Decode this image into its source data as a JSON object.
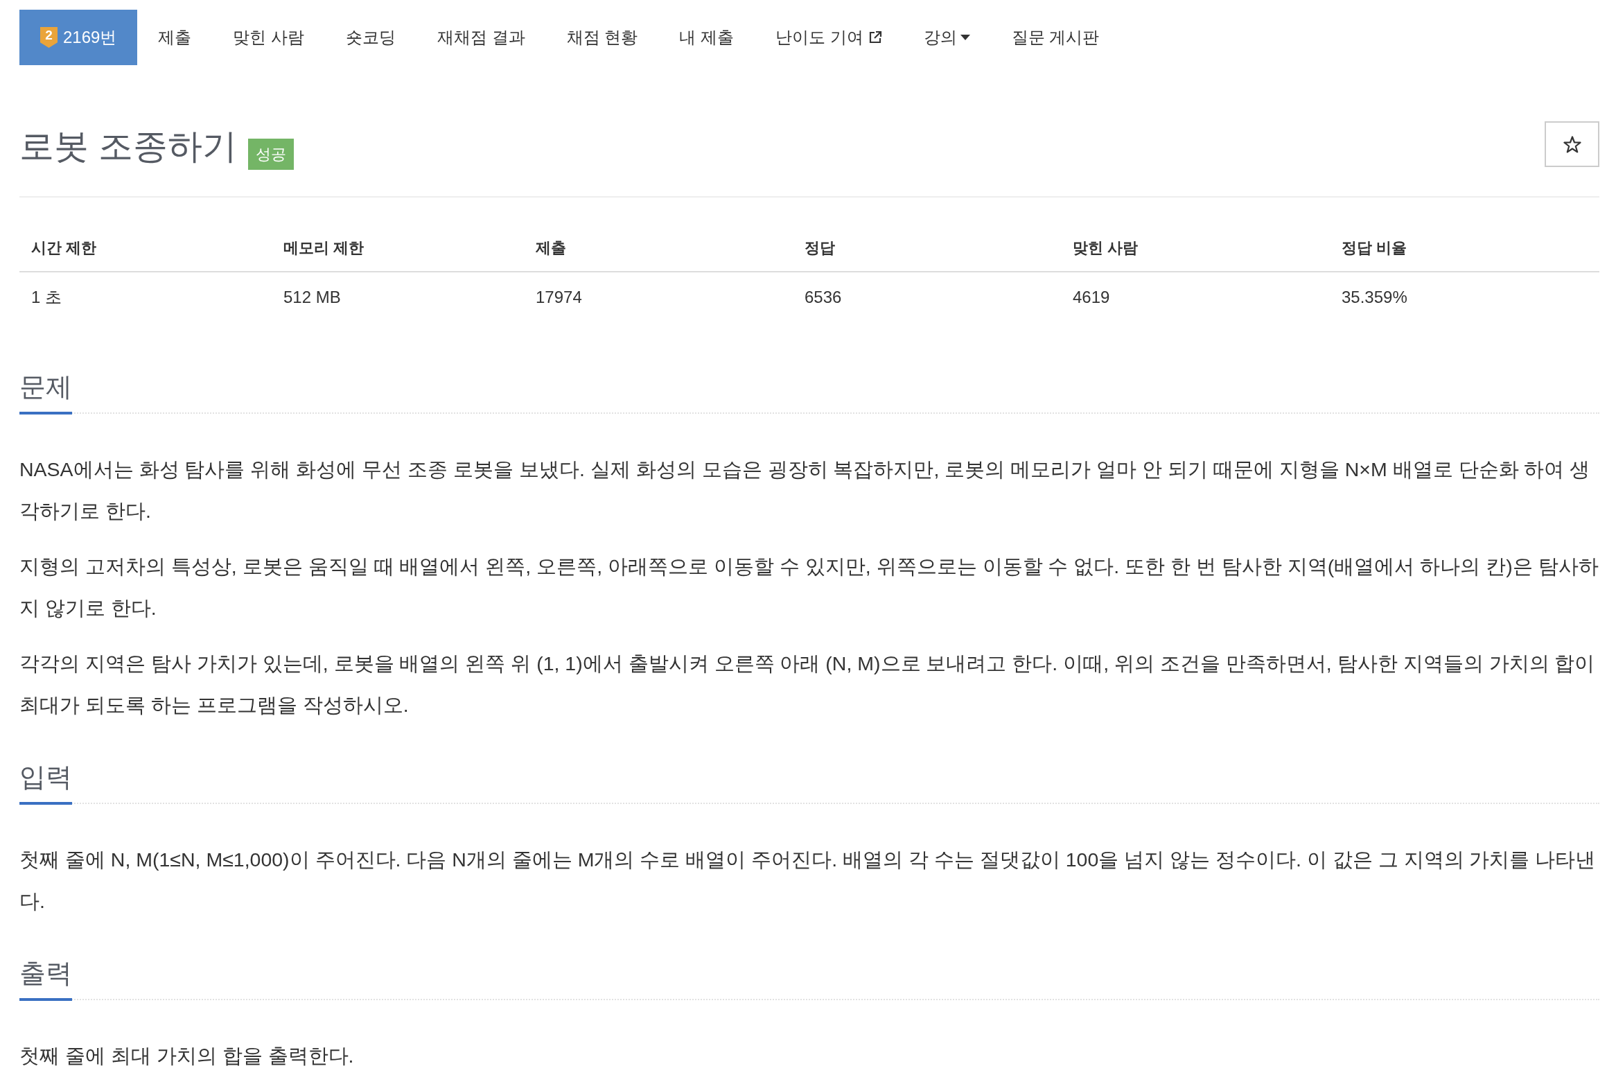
{
  "nav": {
    "tabs": [
      {
        "kind": "problem",
        "tier": "2",
        "label": "2169번",
        "selected": true
      },
      {
        "kind": "link",
        "label": "제출",
        "selected": false
      },
      {
        "kind": "link",
        "label": "맞힌 사람",
        "selected": false
      },
      {
        "kind": "link",
        "label": "숏코딩",
        "selected": false
      },
      {
        "kind": "link",
        "label": "재채점 결과",
        "selected": false
      },
      {
        "kind": "link",
        "label": "채점 현황",
        "selected": false
      },
      {
        "kind": "link",
        "label": "내 제출",
        "selected": false
      },
      {
        "kind": "external",
        "label": "난이도 기여",
        "selected": false
      },
      {
        "kind": "dropdown",
        "label": "강의",
        "selected": false
      },
      {
        "kind": "link",
        "label": "질문 게시판",
        "selected": false
      }
    ]
  },
  "problem": {
    "title": "로봇 조종하기",
    "result_badge": {
      "kind": "success",
      "label": "성공"
    },
    "starred": false
  },
  "limits_table": {
    "columns": [
      "시간 제한",
      "메모리 제한",
      "제출",
      "정답",
      "맞힌 사람",
      "정답 비율"
    ],
    "rows": [
      [
        "1 초",
        "512 MB",
        "17974",
        "6536",
        "4619",
        "35.359%"
      ]
    ]
  },
  "sections": [
    {
      "heading": "문제",
      "paragraphs": [
        "NASA에서는 화성 탐사를 위해 화성에 무선 조종 로봇을 보냈다. 실제 화성의 모습은 굉장히 복잡하지만, 로봇의 메모리가 얼마 안 되기 때문에 지형을 N×M 배열로 단순화 하여 생각하기로 한다.",
        "지형의 고저차의 특성상, 로봇은 움직일 때 배열에서 왼쪽, 오른쪽, 아래쪽으로 이동할 수 있지만, 위쪽으로는 이동할 수 없다. 또한 한 번 탐사한 지역(배열에서 하나의 칸)은 탐사하지 않기로 한다.",
        "각각의 지역은 탐사 가치가 있는데, 로봇을 배열의 왼쪽 위 (1, 1)에서 출발시켜 오른쪽 아래 (N, M)으로 보내려고 한다. 이때, 위의 조건을 만족하면서, 탐사한 지역들의 가치의 합이 최대가 되도록 하는 프로그램을 작성하시오."
      ]
    },
    {
      "heading": "입력",
      "paragraphs": [
        "첫째 줄에 N, M(1≤N, M≤1,000)이 주어진다. 다음 N개의 줄에는 M개의 수로 배열이 주어진다. 배열의 각 수는 절댓값이 100을 넘지 않는 정수이다. 이 값은 그 지역의 가치를 나타낸다."
      ]
    },
    {
      "heading": "출력",
      "paragraphs": [
        "첫째 줄에 최대 가치의 합을 출력한다."
      ]
    }
  ]
}
